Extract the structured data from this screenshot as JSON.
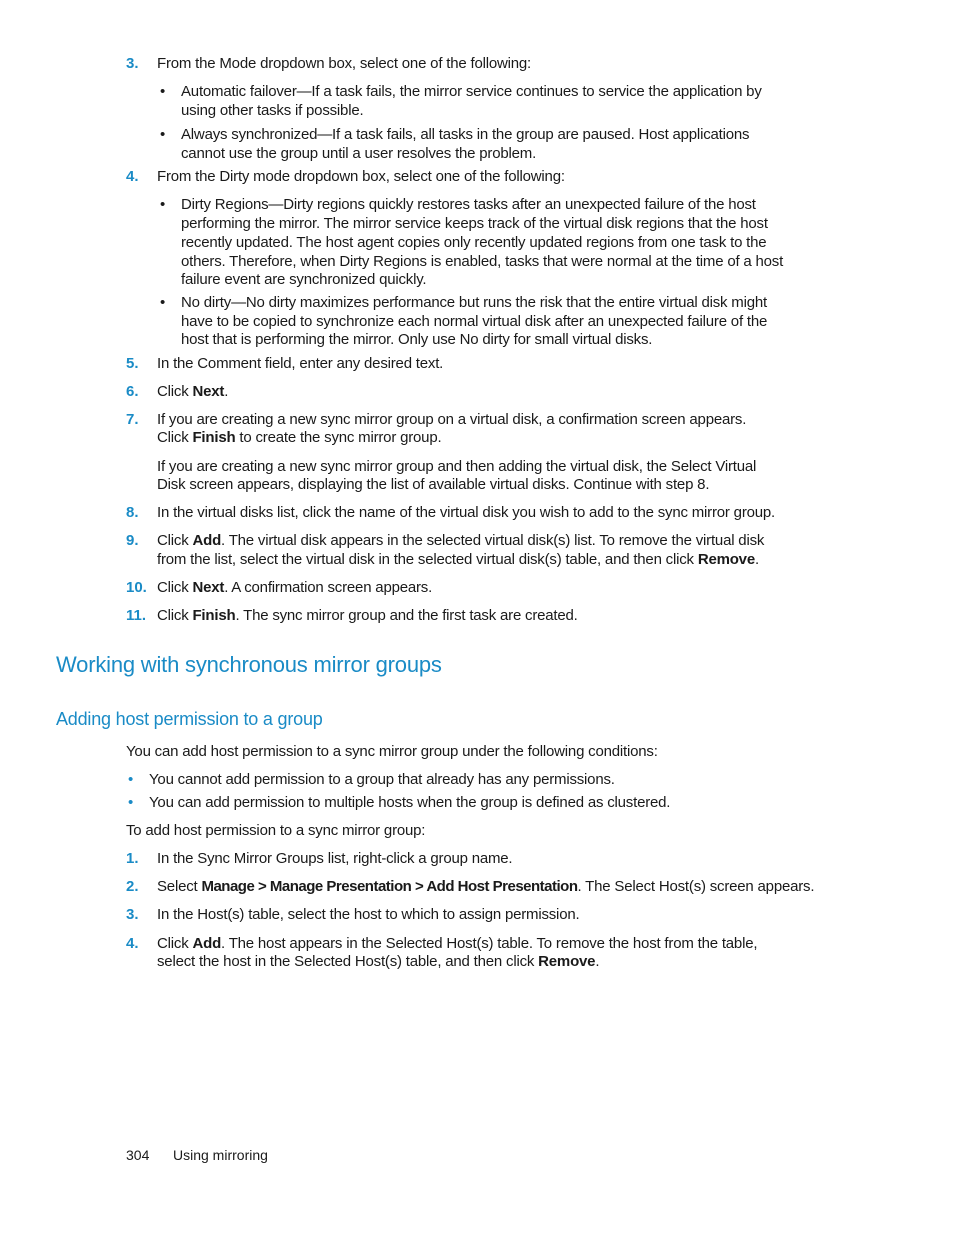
{
  "steps_a": [
    {
      "n": "3.",
      "text": "From the Mode dropdown box, select one of the following:"
    },
    {
      "n": "4.",
      "text": "From the Dirty mode dropdown box, select one of the following:"
    },
    {
      "n": "5.",
      "text": "In the Comment field, enter any desired text."
    },
    {
      "n": "6.",
      "pre": "Click ",
      "bold": "Next",
      "post": "."
    },
    {
      "n": "7.",
      "line1": "If you are creating a new sync mirror group on a virtual disk, a confirmation screen appears.",
      "pre": "Click ",
      "bold": "Finish",
      "post": " to create the sync mirror group.",
      "para2_line1": "If you are creating a new sync mirror group and then adding the virtual disk, the Select Virtual",
      "para2_line2": "Disk screen appears, displaying the list of available virtual disks. Continue with step 8."
    },
    {
      "n": "8.",
      "text": "In the virtual disks list, click the name of the virtual disk you wish to add to the sync mirror group."
    },
    {
      "n": "9.",
      "pre": "Click ",
      "bold": "Add",
      "post": ". The virtual disk appears in the selected virtual disk(s) list. To remove the virtual disk",
      "line2_pre": "from the list, select the virtual disk in the selected virtual disk(s) table, and then click ",
      "line2_bold": "Remove",
      "line2_post": "."
    },
    {
      "n": "10.",
      "pre": "Click ",
      "bold": "Next",
      "post": ". A confirmation screen appears."
    },
    {
      "n": "11.",
      "pre": "Click ",
      "bold": "Finish",
      "post": ". The sync mirror group and the first task are created."
    }
  ],
  "mode_bullets": [
    {
      "line1": "Automatic failover—If a task fails, the mirror service continues to service the application by",
      "line2": "using other tasks if possible."
    },
    {
      "line1": "Always synchronized—If a task fails, all tasks in the group are paused. Host applications",
      "line2": "cannot use the group until a user resolves the problem."
    }
  ],
  "dirty_bullets": [
    {
      "lines": [
        "Dirty Regions—Dirty regions quickly restores tasks after an unexpected failure of the host",
        "performing the mirror. The mirror service keeps track of the virtual disk regions that the host",
        "recently updated. The host agent copies only recently updated regions from one task to the",
        "others. Therefore, when Dirty Regions is enabled, tasks that were normal at the time of a host",
        "failure event are synchronized quickly."
      ]
    },
    {
      "lines": [
        "No dirty—No dirty maximizes performance but runs the risk that the entire virtual disk might",
        "have to be copied to synchronize each normal virtual disk after an unexpected failure of the",
        "host that is performing the mirror. Only use No dirty for small virtual disks."
      ]
    }
  ],
  "section": {
    "heading": "Working with synchronous mirror groups",
    "subheading": "Adding host permission to a group",
    "intro": "You can add host permission to a sync mirror group under the following conditions:",
    "conditions": [
      "You cannot add permission to a group that already has any permissions.",
      "You can add permission to multiple hosts when the group is defined as clustered."
    ],
    "lead": "To add host permission to a sync mirror group:",
    "steps": [
      {
        "n": "1.",
        "text": "In the Sync Mirror Groups list, right-click a group name."
      },
      {
        "n": "2.",
        "pre": "Select ",
        "bold": "Manage > Manage Presentation > Add Host Presentation",
        "post": ". The Select Host(s) screen appears."
      },
      {
        "n": "3.",
        "text": "In the Host(s) table, select the host to which to assign permission."
      },
      {
        "n": "4.",
        "pre": "Click ",
        "bold": "Add",
        "post": ". The host appears in the Selected Host(s) table. To remove the host from the table,",
        "line2_pre": "select the host in the Selected Host(s) table, and then click ",
        "line2_bold": "Remove",
        "line2_post": "."
      }
    ]
  },
  "footer": {
    "page_number": "304",
    "chapter": "Using mirroring"
  },
  "bullet_glyph": "•",
  "accent_color": "#1a8bc6"
}
